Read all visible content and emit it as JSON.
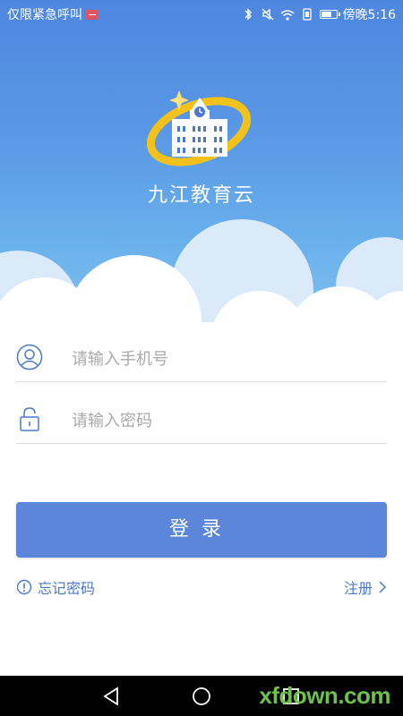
{
  "status_bar": {
    "carrier": "仅限紧急呼叫",
    "time": "傍晚5:16",
    "icons": [
      "sim-alert-icon",
      "bluetooth-icon",
      "mute-icon",
      "wifi-icon",
      "data-icon",
      "battery-icon"
    ]
  },
  "app": {
    "title": "九江教育云",
    "logo": "school-building-logo"
  },
  "login_form": {
    "phone_placeholder": "请输入手机号",
    "password_placeholder": "请输入密码",
    "login_label": "登录",
    "forgot_label": "忘记密码",
    "register_label": "注册"
  },
  "nav": {
    "buttons": [
      "back-icon",
      "home-icon",
      "recents-icon"
    ]
  },
  "watermark": "xfdown.com",
  "colors": {
    "primary": "#5b86d9",
    "link": "#4a78cf",
    "hero_top": "#4f86df",
    "hero_bottom": "#7fc0f0",
    "logo_ring": "#f2c21b"
  }
}
